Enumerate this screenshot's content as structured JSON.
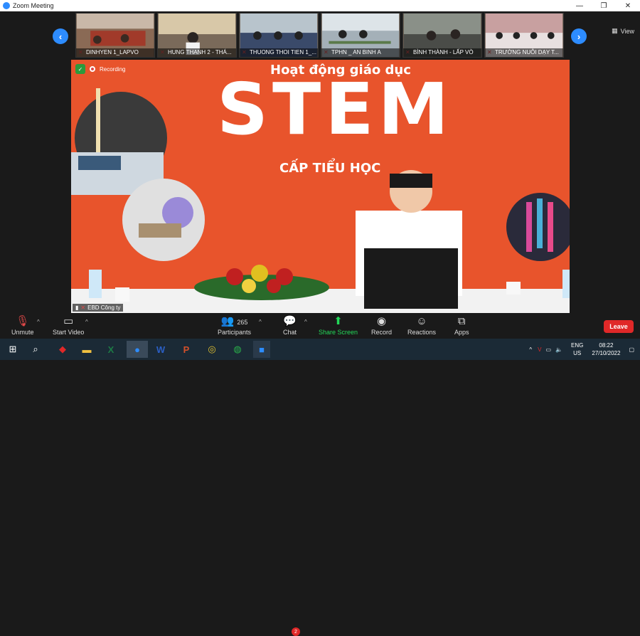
{
  "window": {
    "title": "Zoom Meeting"
  },
  "gallery": {
    "view_label": "View",
    "participants": [
      {
        "name": "DINHYEN 1_LAPVO"
      },
      {
        "name": "HUNG THANH 2 - THÁ..."
      },
      {
        "name": "THUONG THOI TIEN 1_..."
      },
      {
        "name": "TPHN _ AN BINH A"
      },
      {
        "name": "BÌNH THÀNH - LẤP VÒ"
      },
      {
        "name": "TRƯỜNG NUÔI DẠY T..."
      }
    ]
  },
  "main": {
    "recording_label": "Recording",
    "slide_line1": "Hoạt động giáo dục",
    "slide_line2": "STEM",
    "slide_line3": "CẤP TIỂU HỌC",
    "speaker_name": "EBD Công ty"
  },
  "toolbar": {
    "unmute": "Unmute",
    "start_video": "Start Video",
    "participants_label": "Participants",
    "participants_count": "265",
    "chat_label": "Chat",
    "chat_badge": "2",
    "share_label": "Share Screen",
    "record_label": "Record",
    "reactions_label": "Reactions",
    "apps_label": "Apps",
    "leave_label": "Leave",
    "share_color": "#23d959"
  },
  "taskbar": {
    "lang_top": "ENG",
    "lang_bottom": "US",
    "time": "08:22",
    "date": "27/10/2022"
  }
}
